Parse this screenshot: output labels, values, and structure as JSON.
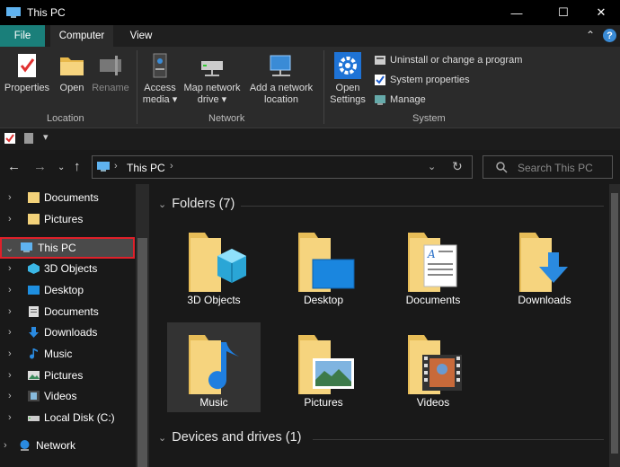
{
  "window": {
    "title": "This PC"
  },
  "tabs": {
    "file": "File",
    "computer": "Computer",
    "view": "View"
  },
  "ribbon": {
    "location": {
      "label": "Location",
      "properties": "Properties",
      "open": "Open",
      "rename": "Rename"
    },
    "network": {
      "label": "Network",
      "access_media_1": "Access",
      "access_media_2": "media ▾",
      "map_drive_1": "Map network",
      "map_drive_2": "drive ▾",
      "add_location_1": "Add a network",
      "add_location_2": "location"
    },
    "system": {
      "label": "System",
      "open_settings_1": "Open",
      "open_settings_2": "Settings",
      "uninstall": "Uninstall or change a program",
      "system_properties": "System properties",
      "manage": "Manage"
    }
  },
  "address": {
    "crumb": "This PC"
  },
  "search": {
    "placeholder": "Search This PC"
  },
  "sidebar": {
    "items": [
      {
        "label": "Documents"
      },
      {
        "label": "Pictures"
      },
      {
        "label": "This PC"
      },
      {
        "label": "3D Objects"
      },
      {
        "label": "Desktop"
      },
      {
        "label": "Documents"
      },
      {
        "label": "Downloads"
      },
      {
        "label": "Music"
      },
      {
        "label": "Pictures"
      },
      {
        "label": "Videos"
      },
      {
        "label": "Local Disk (C:)"
      },
      {
        "label": "Network"
      }
    ]
  },
  "main": {
    "folders_header": "Folders (7)",
    "devices_header": "Devices and drives (1)",
    "folders": [
      {
        "label": "3D Objects"
      },
      {
        "label": "Desktop"
      },
      {
        "label": "Documents"
      },
      {
        "label": "Downloads"
      },
      {
        "label": "Music"
      },
      {
        "label": "Pictures"
      },
      {
        "label": "Videos"
      }
    ]
  },
  "colors": {
    "file_tab": "#1a7f7a",
    "selection_outline": "#e0202a",
    "folder": "#f3d27a"
  }
}
